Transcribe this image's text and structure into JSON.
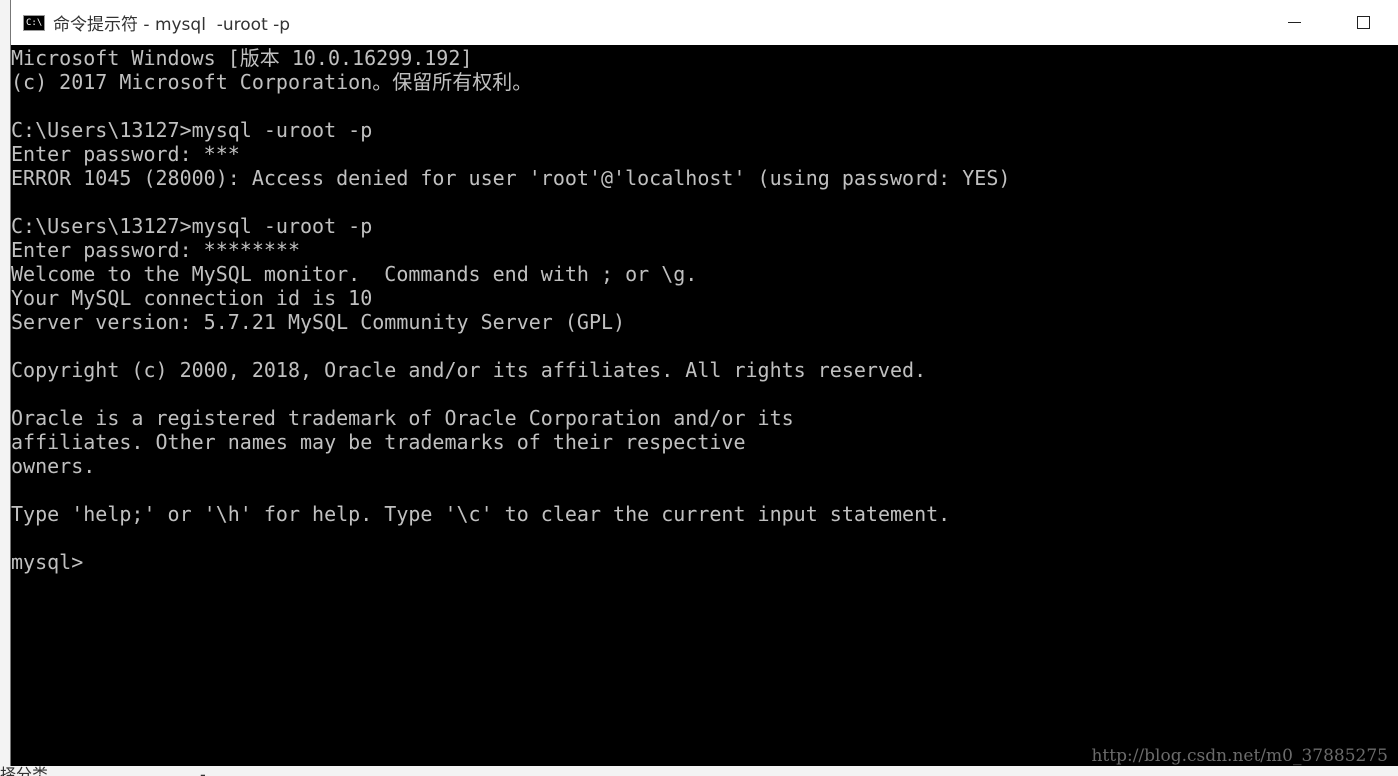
{
  "window": {
    "title": "命令提示符 - mysql  -uroot -p",
    "icon_label": "C:\\"
  },
  "console": {
    "lines": [
      "Microsoft Windows [版本 10.0.16299.192]",
      "(c) 2017 Microsoft Corporation。保留所有权利。",
      "",
      "C:\\Users\\13127>mysql -uroot -p",
      "Enter password: ***",
      "ERROR 1045 (28000): Access denied for user 'root'@'localhost' (using password: YES)",
      "",
      "C:\\Users\\13127>mysql -uroot -p",
      "Enter password: ********",
      "Welcome to the MySQL monitor.  Commands end with ; or \\g.",
      "Your MySQL connection id is 10",
      "Server version: 5.7.21 MySQL Community Server (GPL)",
      "",
      "Copyright (c) 2000, 2018, Oracle and/or its affiliates. All rights reserved.",
      "",
      "Oracle is a registered trademark of Oracle Corporation and/or its",
      "affiliates. Other names may be trademarks of their respective",
      "owners.",
      "",
      "Type 'help;' or '\\h' for help. Type '\\c' to clear the current input statement.",
      "",
      "mysql>"
    ]
  },
  "watermark": "http://blog.csdn.net/m0_37885275",
  "background_page": {
    "bottom_text": "择分类",
    "bottom_mark": "-"
  },
  "colors": {
    "console_bg": "#000000",
    "console_fg": "#c0c0c0",
    "titlebar_bg": "#ffffff"
  }
}
